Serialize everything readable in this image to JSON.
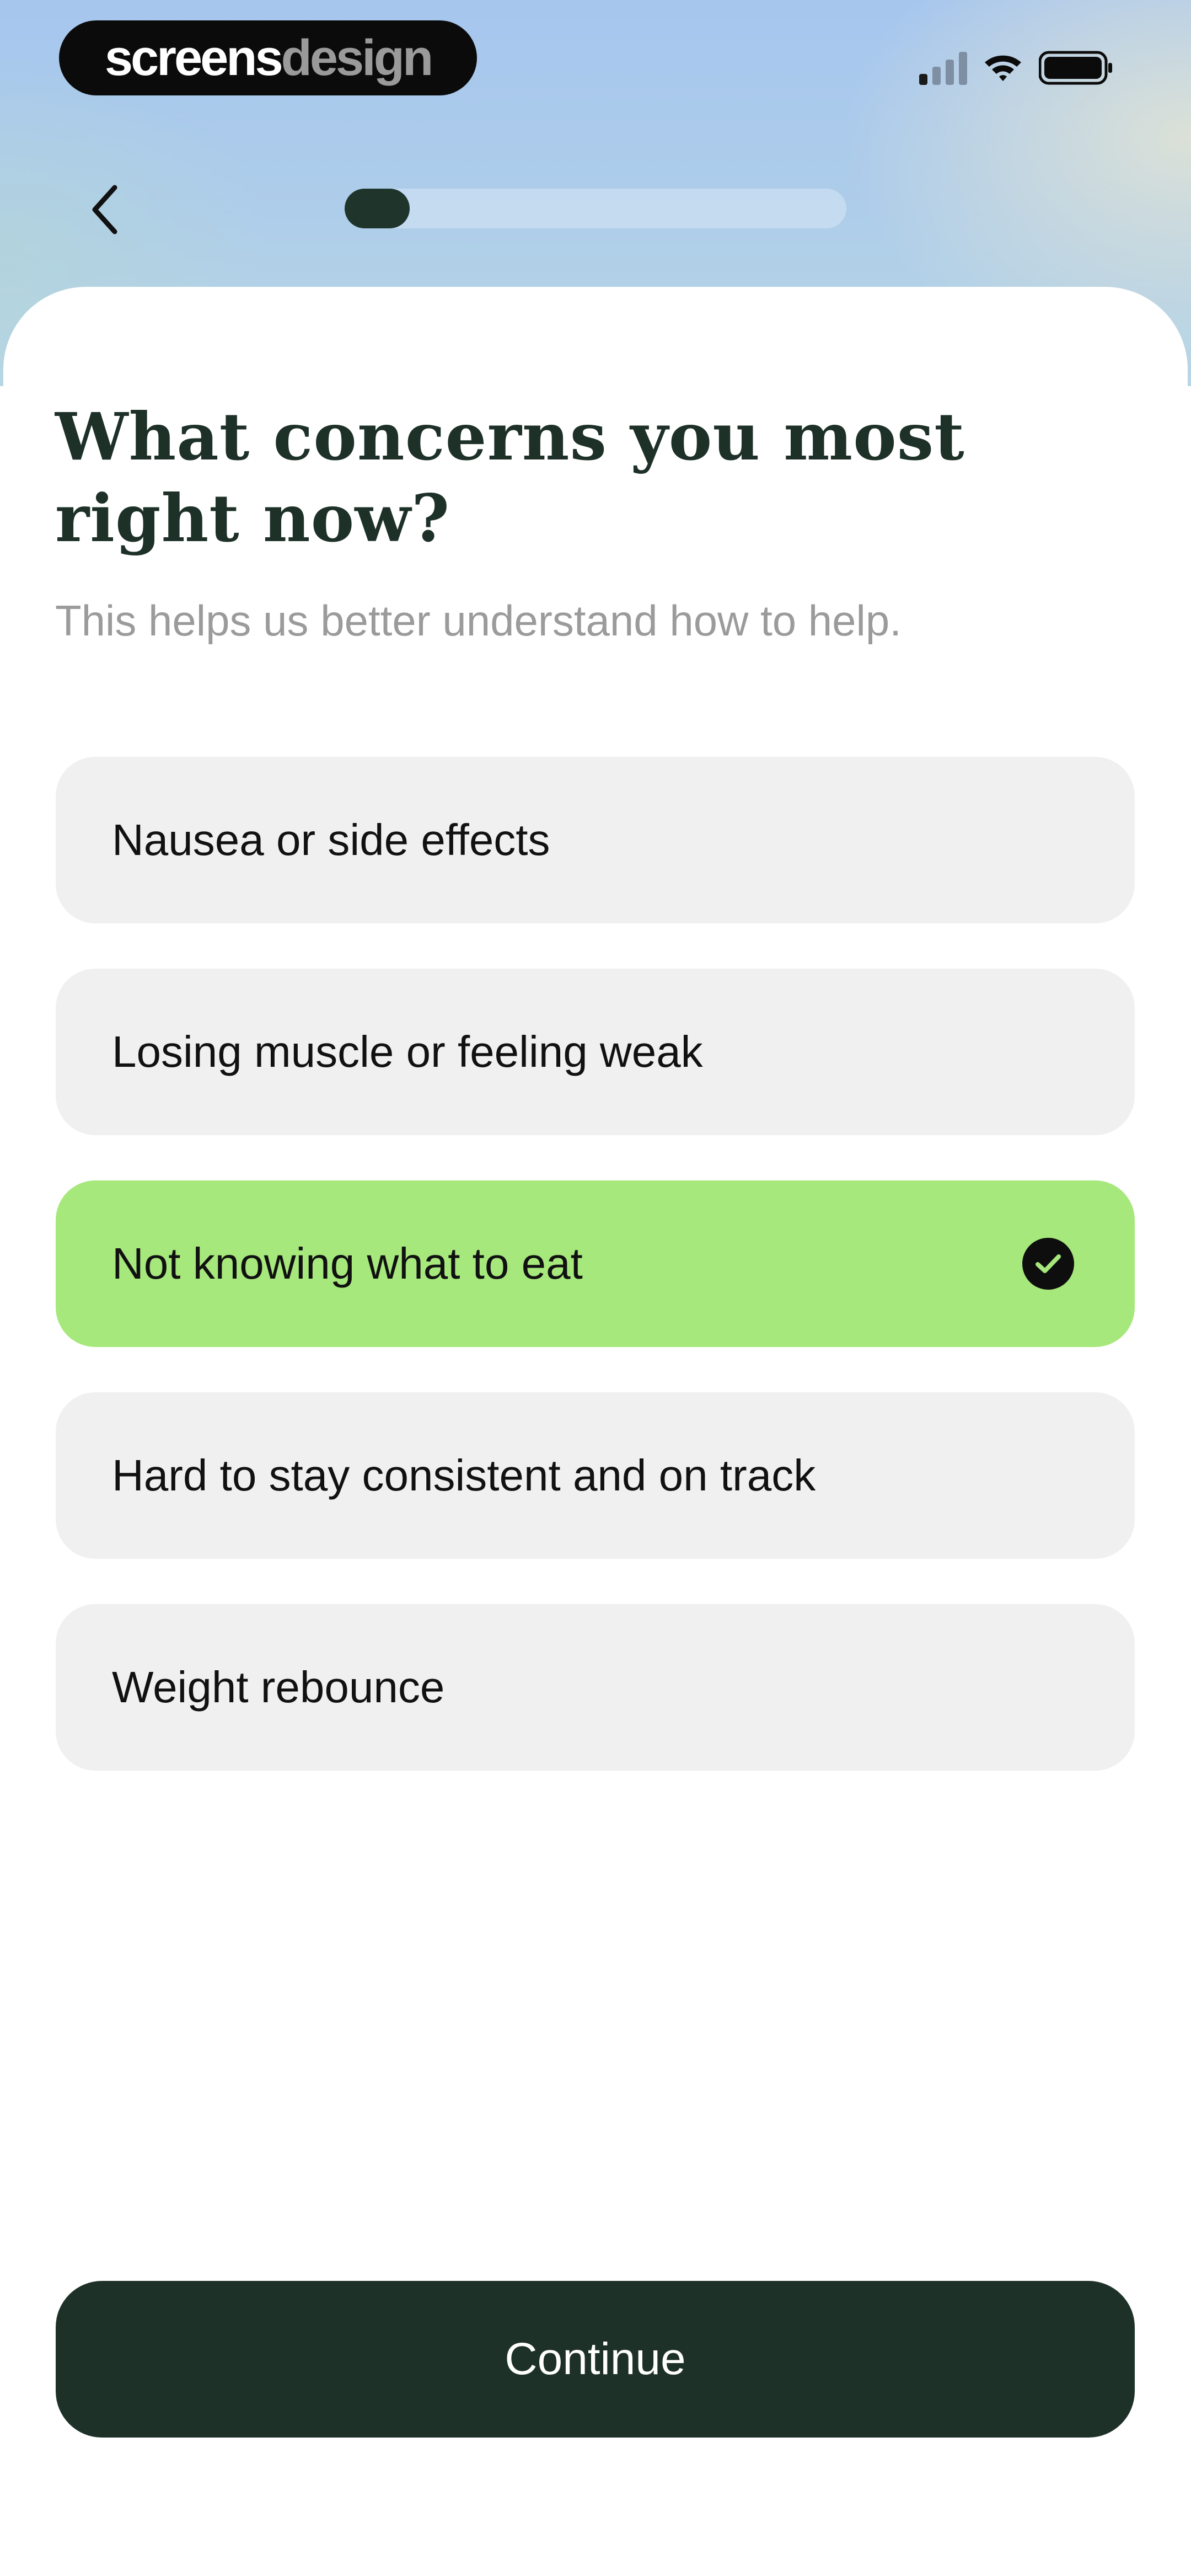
{
  "status_bar": {
    "brand_part1": "screens",
    "brand_part2": "design",
    "signal_icon": "cellular-signal-icon",
    "wifi_icon": "wifi-icon",
    "battery_icon": "battery-icon"
  },
  "nav": {
    "back_icon": "chevron-left-icon",
    "progress": 0.13
  },
  "question": {
    "title": "What concerns you most right now?",
    "subtitle": "This helps us better understand how to help."
  },
  "options": [
    {
      "label": "Nausea or side effects",
      "selected": false
    },
    {
      "label": "Losing muscle or feeling weak",
      "selected": false
    },
    {
      "label": "Not knowing what to eat",
      "selected": true
    },
    {
      "label": "Hard to stay consistent and on track",
      "selected": false
    },
    {
      "label": "Weight rebounce",
      "selected": false
    }
  ],
  "continue_label": "Continue",
  "colors": {
    "primary_dark": "#1e3129",
    "selected_green": "#a6e87c",
    "option_bg": "#f0f0f0",
    "subtitle_gray": "#9b9b9b"
  }
}
